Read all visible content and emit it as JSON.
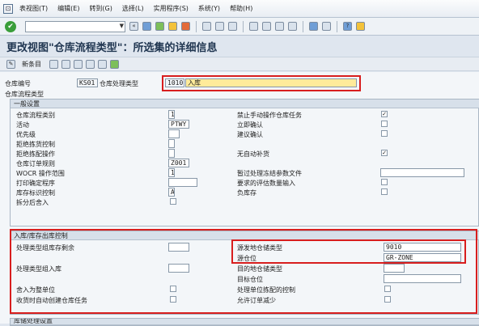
{
  "menu": {
    "items": [
      "表视图(T)",
      "编辑(E)",
      "转到(G)",
      "选择(L)",
      "实用程序(S)",
      "系统(Y)",
      "帮助(H)"
    ]
  },
  "page_title": "更改视图\"仓库流程类型\"：所选集的详细信息",
  "app_toolbar": {
    "new_entry": "新条目"
  },
  "header": {
    "warehouse_label": "仓库编号",
    "warehouse_value": "KS01",
    "process_type_label": "仓库处理类型",
    "process_type_value": "1010",
    "process_type_desc": "入库"
  },
  "section_title": "仓库流程类型",
  "general": {
    "title": "一般设置",
    "left": [
      {
        "label": "仓库流程类别",
        "value": "1",
        "kind": "field",
        "w": 8
      },
      {
        "label": "活动",
        "value": "PTWY",
        "kind": "field",
        "w": 26
      },
      {
        "label": "优先级",
        "value": "",
        "kind": "field",
        "w": 14
      },
      {
        "label": "拒绝拣货控制",
        "value": "",
        "kind": "field",
        "w": 8
      },
      {
        "label": "拒绝拣配操作",
        "value": "",
        "kind": "field",
        "w": 8
      },
      {
        "label": "仓库订单规则",
        "value": "Z001",
        "kind": "field",
        "w": 26
      },
      {
        "label": "WOCR 操作范围",
        "value": "1",
        "kind": "field",
        "w": 8
      },
      {
        "label": "打印确定程序",
        "value": "",
        "kind": "field",
        "w": 36
      },
      {
        "label": "库存标识控制",
        "value": "A",
        "kind": "field",
        "w": 8
      },
      {
        "label": "拆分后舍入",
        "value": "",
        "kind": "checkbox"
      }
    ],
    "right": [
      {
        "label": "禁止手动操作仓库任务",
        "checked": true
      },
      {
        "label": "立即确认",
        "checked": false
      },
      {
        "label": "建议确认",
        "checked": false
      },
      {
        "label": "",
        "checked": null
      },
      {
        "label": "无自动补货",
        "checked": true
      },
      {
        "label": "",
        "checked": null
      },
      {
        "label": "暂过处理冻结参数文件",
        "value": "",
        "kind": "field"
      },
      {
        "label": "要求的评估数量输入",
        "checked": false
      },
      {
        "label": "负库存",
        "checked": false
      }
    ]
  },
  "inout": {
    "title": "入库/库存出库控制",
    "rows": [
      {
        "left_label": "处理类型组库存剩余",
        "left_kind": "field",
        "right_label": "源发地仓储类型",
        "right_value": "9010"
      },
      {
        "left_label": "",
        "left_kind": "none",
        "right_label": "源仓位",
        "right_value": "GR-ZONE"
      },
      {
        "left_label": "处理类型组入库",
        "left_kind": "field",
        "right_label": "目的地仓储类型",
        "right_value": ""
      },
      {
        "left_label": "",
        "left_kind": "none",
        "right_label": "目标仓位",
        "right_value": ""
      },
      {
        "left_label": "舍入为整单位",
        "left_kind": "checkbox",
        "right_label": "处理单位拣配的控制",
        "right_kind": "checkbox"
      },
      {
        "left_label": "收货时自动创建仓库任务",
        "left_kind": "checkbox",
        "right_label": "允许订单减少",
        "right_kind": "checkbox"
      }
    ]
  },
  "next_section": "库储处理设置",
  "colors": {
    "highlight_border": "#d81e1e",
    "input_focus": "#ffeb9a",
    "title": "#1f3550"
  }
}
